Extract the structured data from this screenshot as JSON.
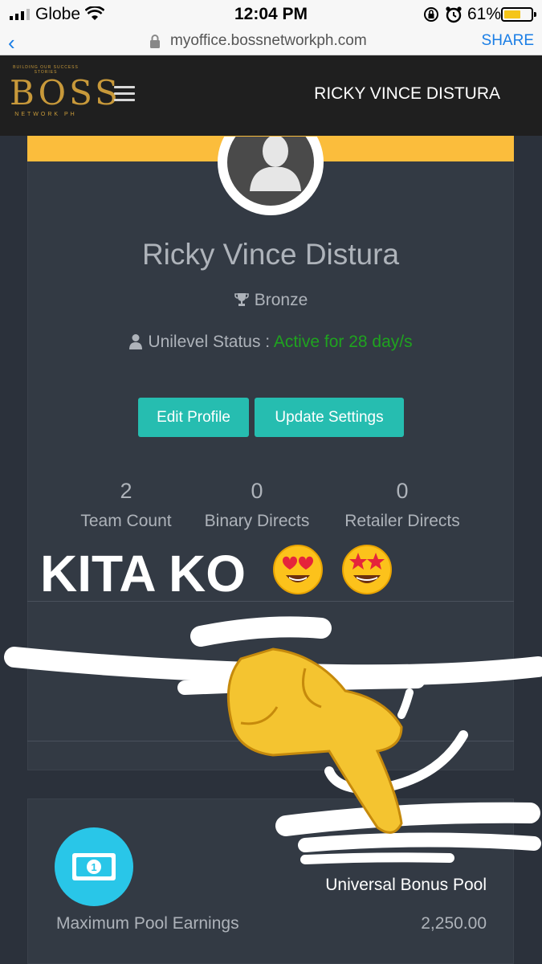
{
  "status_bar": {
    "carrier": "Globe",
    "time": "12:04 PM",
    "battery": "61%",
    "battery_level": 0.61,
    "icons": [
      "signal-icon",
      "wifi-icon",
      "orientation-lock-icon",
      "alarm-icon",
      "battery-icon"
    ]
  },
  "browser": {
    "url": "myoffice.bossnetworkph.com",
    "share": "SHARE",
    "back_icon": "chevron-left-icon",
    "lock_icon": "lock-icon"
  },
  "header": {
    "logo": {
      "tagline": "BUILDING OUR SUCCESS STORIES",
      "name": "BOSS",
      "subtitle": "NETWORK PH"
    },
    "menu_icon": "hamburger-icon",
    "user_name": "RICKY VINCE DISTURA"
  },
  "profile": {
    "name": "Ricky Vince Distura",
    "rank": "Bronze",
    "rank_icon": "trophy-icon",
    "status_label": "Unilevel Status :",
    "status_value": "Active for 28 day/s",
    "status_icon": "user-icon",
    "buttons": {
      "edit": "Edit Profile",
      "update": "Update Settings"
    },
    "stats": [
      {
        "value": "2",
        "label": "Team Count"
      },
      {
        "value": "0",
        "label": "Binary Directs"
      },
      {
        "value": "0",
        "label": "Retailer Directs"
      }
    ]
  },
  "overlay": {
    "caption": "KITA KO",
    "emojis": [
      "heart-eyes-emoji",
      "star-struck-emoji",
      "pointing-hand-emoji"
    ]
  },
  "bonus": {
    "title": "Universal Bonus Pool",
    "label": "Maximum Pool Earnings",
    "value": "2,250.00",
    "icon": "money-icon"
  },
  "colors": {
    "accent_teal": "#26bdb0",
    "active_green": "#1fa31f",
    "band_yellow": "#fbbd3c",
    "money_cyan": "#29c6e8"
  }
}
